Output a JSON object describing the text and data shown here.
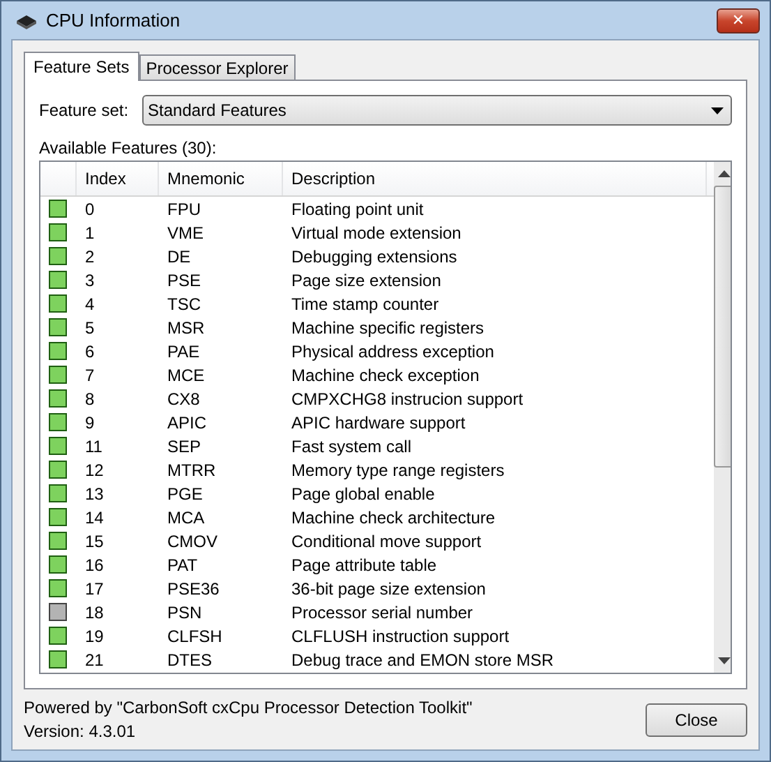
{
  "window": {
    "title": "CPU Information",
    "close": "✕"
  },
  "tabs": [
    {
      "label": "Feature Sets",
      "selected": true
    },
    {
      "label": "Processor Explorer",
      "selected": false
    }
  ],
  "feature_set": {
    "label": "Feature set:",
    "value": "Standard Features"
  },
  "list_label": "Available Features (30):",
  "table": {
    "columns": [
      "Index",
      "Mnemonic",
      "Description"
    ],
    "rows": [
      {
        "supported": true,
        "index": "0",
        "mnemonic": "FPU",
        "description": "Floating point unit"
      },
      {
        "supported": true,
        "index": "1",
        "mnemonic": "VME",
        "description": "Virtual mode extension"
      },
      {
        "supported": true,
        "index": "2",
        "mnemonic": "DE",
        "description": "Debugging extensions"
      },
      {
        "supported": true,
        "index": "3",
        "mnemonic": "PSE",
        "description": "Page size extension"
      },
      {
        "supported": true,
        "index": "4",
        "mnemonic": "TSC",
        "description": "Time stamp counter"
      },
      {
        "supported": true,
        "index": "5",
        "mnemonic": "MSR",
        "description": "Machine specific registers"
      },
      {
        "supported": true,
        "index": "6",
        "mnemonic": "PAE",
        "description": "Physical address exception"
      },
      {
        "supported": true,
        "index": "7",
        "mnemonic": "MCE",
        "description": "Machine check exception"
      },
      {
        "supported": true,
        "index": "8",
        "mnemonic": "CX8",
        "description": "CMPXCHG8 instrucion support"
      },
      {
        "supported": true,
        "index": "9",
        "mnemonic": "APIC",
        "description": "APIC hardware support"
      },
      {
        "supported": true,
        "index": "11",
        "mnemonic": "SEP",
        "description": "Fast system call"
      },
      {
        "supported": true,
        "index": "12",
        "mnemonic": "MTRR",
        "description": "Memory type range registers"
      },
      {
        "supported": true,
        "index": "13",
        "mnemonic": "PGE",
        "description": "Page global enable"
      },
      {
        "supported": true,
        "index": "14",
        "mnemonic": "MCA",
        "description": "Machine check architecture"
      },
      {
        "supported": true,
        "index": "15",
        "mnemonic": "CMOV",
        "description": "Conditional move support"
      },
      {
        "supported": true,
        "index": "16",
        "mnemonic": "PAT",
        "description": "Page attribute table"
      },
      {
        "supported": true,
        "index": "17",
        "mnemonic": "PSE36",
        "description": "36-bit page size extension"
      },
      {
        "supported": false,
        "index": "18",
        "mnemonic": "PSN",
        "description": "Processor serial number"
      },
      {
        "supported": true,
        "index": "19",
        "mnemonic": "CLFSH",
        "description": "CLFLUSH instruction support"
      },
      {
        "supported": true,
        "index": "21",
        "mnemonic": "DTES",
        "description": "Debug trace and EMON store MSR"
      }
    ]
  },
  "footer": {
    "powered_by": "Powered by \"CarbonSoft cxCpu Processor Detection Toolkit\"",
    "version": "Version: 4.3.01"
  },
  "buttons": [
    "Close"
  ]
}
